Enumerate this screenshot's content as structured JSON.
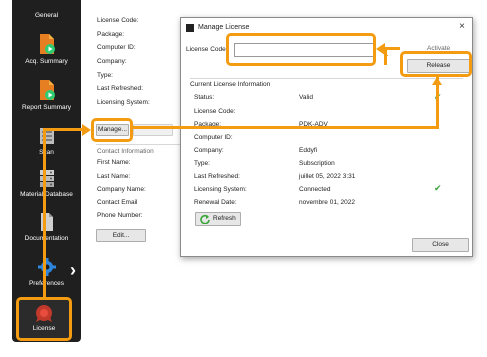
{
  "sidebar": {
    "title": "General",
    "items": [
      {
        "label": "Acq. Summary",
        "icon": "doc-play-icon"
      },
      {
        "label": "Report Summary",
        "icon": "doc-play-icon"
      },
      {
        "label": "Scan",
        "icon": "scan-icon"
      },
      {
        "label": "Material Database",
        "icon": "database-icon"
      },
      {
        "label": "Documentation",
        "icon": "doc-icon"
      },
      {
        "label": "Preferences",
        "icon": "gear-icon"
      },
      {
        "label": "License",
        "icon": "license-icon"
      }
    ]
  },
  "license_panel": {
    "fields": [
      "License Code:",
      "Package:",
      "Computer ID:",
      "Company:",
      "Type:",
      "Last Refreshed:",
      "Licensing System:"
    ],
    "manage_button": "Manage...",
    "contact_header": "Contact Information",
    "contact_fields": [
      "First Name:",
      "Last Name:",
      "Company Name:",
      "Contact Email",
      "Phone Number:"
    ],
    "edit_button": "Edit..."
  },
  "dialog": {
    "title": "Manage License",
    "close_glyph": "×",
    "license_code_label": "License Code",
    "activate_button": "Activate",
    "release_button": "Release",
    "section_title": "Current License Information",
    "info": [
      {
        "label": "Status:",
        "value": "Valid"
      },
      {
        "label": "License Code:",
        "value": ""
      },
      {
        "label": "Package:",
        "value": "PDK-ADV"
      },
      {
        "label": "Computer ID:",
        "value": ""
      },
      {
        "label": "Company:",
        "value": "Eddyfi"
      },
      {
        "label": "Type:",
        "value": "Subscription"
      },
      {
        "label": "Last Refreshed:",
        "value": "juillet 05, 2022 3:31"
      },
      {
        "label": "Licensing System:",
        "value": "Connected"
      },
      {
        "label": "Renewal Date:",
        "value": "novembre 01, 2022"
      }
    ],
    "check_glyph": "✔",
    "refresh_button": "Refresh",
    "close_button": "Close"
  },
  "colors": {
    "annotation": "#f39c12",
    "sidebar_bg": "#1f1f1f",
    "accent_green": "#3aa63a",
    "icon_orange": "#e67e22"
  }
}
